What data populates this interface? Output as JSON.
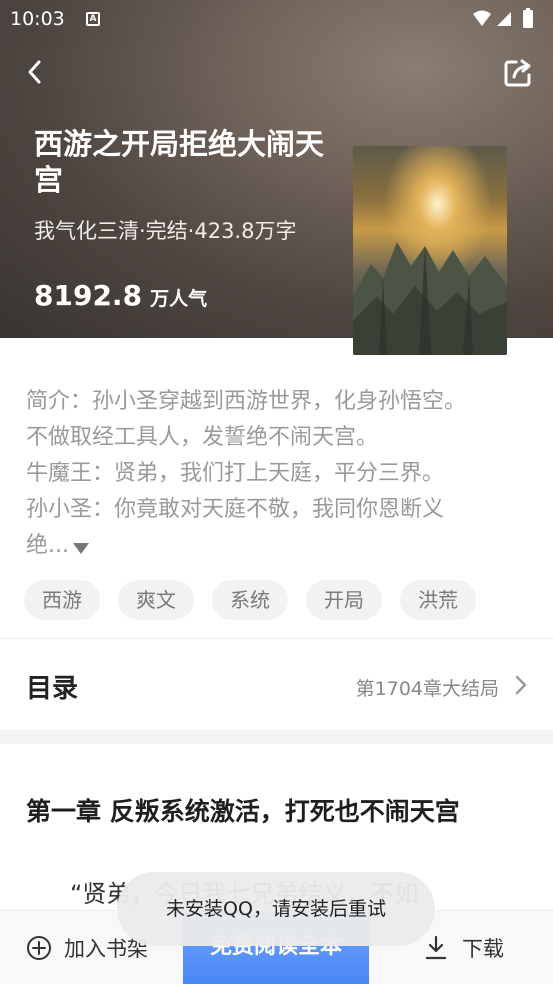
{
  "status_bar": {
    "time": "10:03"
  },
  "book": {
    "title": "西游之开局拒绝大闹天宫",
    "meta": "我气化三清·完结·423.8万字",
    "popularity_value": "8192.8",
    "popularity_unit": "万人气"
  },
  "intro": {
    "lines": [
      "简介：孙小圣穿越到西游世界，化身孙悟空。",
      "不做取经工具人，发誓绝不闹天宫。",
      "牛魔王：贤弟，我们打上天庭，平分三界。",
      "孙小圣：你竟敢对天庭不敬，我同你恩断义",
      "绝..."
    ]
  },
  "tags": [
    "西游",
    "爽文",
    "系统",
    "开局",
    "洪荒"
  ],
  "catalog": {
    "title": "目录",
    "latest": "第1704章大结局"
  },
  "chapter": {
    "title": "第一章 反叛系统激活，打死也不闹天宫",
    "text": "“贤弟，今日我七兄弟结义，不如"
  },
  "bottom_bar": {
    "add_shelf": "加入书架",
    "read": "免费阅读全本",
    "download": "下载"
  },
  "toast": "未安装QQ，请安装后重试",
  "colors": {
    "accent": "#4a86f5",
    "hero_bg": "#4d4540"
  }
}
